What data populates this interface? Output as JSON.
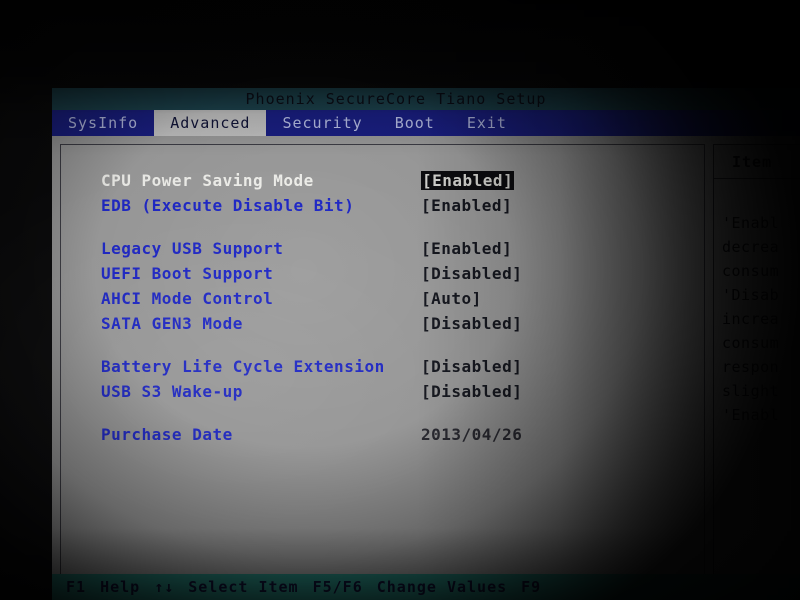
{
  "window": {
    "title": "Phoenix SecureCore Tiano Setup"
  },
  "colors": {
    "title_bar": "#1d4550",
    "menu_bar": "#1a1f84",
    "active_tab_bg": "#c3c3c3",
    "panel_bg": "#9d9d9d",
    "label_blue": "#1f28c8",
    "status_bar": "#2a9186",
    "selection_bg": "#0c0c10"
  },
  "menu": {
    "tabs": [
      {
        "label": "SysInfo",
        "active": false
      },
      {
        "label": "Advanced",
        "active": true
      },
      {
        "label": "Security",
        "active": false
      },
      {
        "label": "Boot",
        "active": false
      },
      {
        "label": "Exit",
        "active": false
      }
    ]
  },
  "settings": {
    "group1": [
      {
        "label": "CPU Power Saving Mode",
        "value": "[Enabled]",
        "selected": true
      },
      {
        "label": "EDB (Execute Disable Bit)",
        "value": "[Enabled]",
        "selected": false
      }
    ],
    "group2": [
      {
        "label": "Legacy USB Support",
        "value": "[Enabled]",
        "selected": false
      },
      {
        "label": "UEFI Boot Support",
        "value": "[Disabled]",
        "selected": false
      },
      {
        "label": "AHCI Mode Control",
        "value": "[Auto]",
        "selected": false
      },
      {
        "label": "SATA GEN3 Mode",
        "value": "[Disabled]",
        "selected": false
      }
    ],
    "group3": [
      {
        "label": "Battery Life Cycle Extension",
        "value": "[Disabled]",
        "selected": false
      },
      {
        "label": "USB S3 Wake-up",
        "value": "[Disabled]",
        "selected": false
      }
    ],
    "group4": [
      {
        "label": "Purchase Date",
        "value": "2013/04/26",
        "selected": false
      }
    ]
  },
  "help": {
    "title": "Item",
    "lines": [
      "'Enabl",
      "decrea",
      "consum",
      "'Disab",
      "increa",
      "consum",
      "respon",
      "slight",
      "'Enabl"
    ]
  },
  "status_bar": {
    "items": [
      {
        "key": "F1",
        "desc": "Help"
      },
      {
        "key": "↑↓",
        "desc": "Select Item"
      },
      {
        "key": "F5/F6",
        "desc": "Change Values"
      },
      {
        "key": "F9",
        "desc": ""
      }
    ]
  }
}
